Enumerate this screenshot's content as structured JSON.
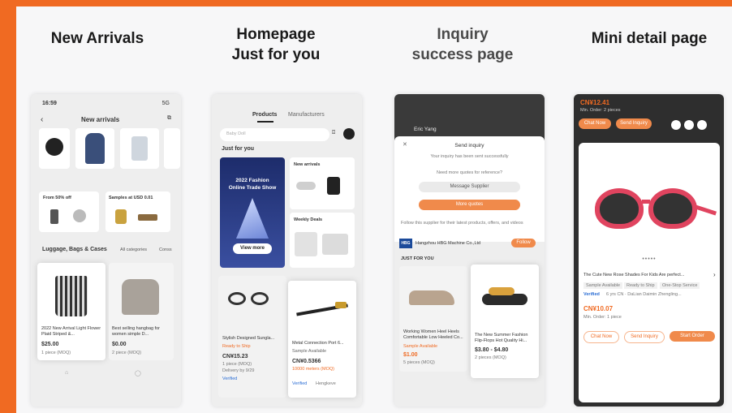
{
  "columns": [
    {
      "title": "New Arrivals"
    },
    {
      "title_line1": "Homepage",
      "title_line2": "Just for you"
    },
    {
      "title_line1": "Inquiry",
      "title_line2": "success page"
    },
    {
      "title": "Mini detail page"
    }
  ],
  "phone1": {
    "time": "16:59",
    "signal": "5G",
    "header": "New arrivals",
    "promo_left": "From 50% off",
    "promo_right": "Samples at USD 0.01",
    "category_tabs": [
      "Luggage, Bags & Cases",
      "All categories",
      "Conss"
    ],
    "product1": {
      "title": "2022 New Arrival Light Flower Plaid Striped &...",
      "price": "$25.00",
      "moq": "1 piece (MOQ)"
    },
    "product2": {
      "title": "Best selling hangbag for women simple D...",
      "price": "$0.00",
      "moq": "2 piece (MOQ)"
    }
  },
  "phone2": {
    "tabs": [
      "Products",
      "Manufacturers"
    ],
    "search_placeholder": "Baby Doll",
    "section": "Just for you",
    "banner": {
      "title": "2022 Fashion Online Trade Show",
      "cta": "View more"
    },
    "new_arrivals": "New arrivals",
    "weekly_deals": "Weekly Deals",
    "product1": {
      "title": "Stylish Designed Sungla...",
      "tag": "Ready to Ship",
      "price": "CN¥15.23",
      "moq": "1 piece (MOQ)",
      "delivery": "Delivery by 9/29",
      "verified": "Verified"
    },
    "product2": {
      "title": "Metal Connection Port 6...",
      "tag": "Sample Available",
      "price": "CN¥0.5366",
      "moq": "10000 meters (MOQ)",
      "verified": "Verified",
      "supplier": "Hengkeve"
    }
  },
  "phone3": {
    "chat_name": "Eric Yang",
    "sheet_title": "Send inquiry",
    "sent_msg": "Your inquiry has been sent successfully",
    "followup": "Need more quotes for reference?",
    "btn_message": "Message Supplier",
    "btn_quotes": "More quotes",
    "follow_text": "Follow this supplier for their latest products, offers, and videos",
    "supplier_badge": "HBG",
    "supplier": "Hangzhou HBG Machine Co.,Ltd",
    "follow_btn": "Follow",
    "section": "JUST FOR YOU",
    "product1": {
      "title": "Working Women Heel Heels Comfortable Low Heeled Co...",
      "tag": "Sample Available",
      "price": "$1.00",
      "moq": "5 pieces (MOQ)"
    },
    "product2": {
      "title": "The New Summer Fashion Flip-Flops Hot Quality Hi...",
      "price": "$3.80 - $4.80",
      "moq": "2 pieces (MOQ)"
    }
  },
  "phone4": {
    "price_top": "CN¥12.41",
    "moq_top": "Min. Order: 2 pieces",
    "btn_chat": "Chat Now",
    "btn_inquiry": "Send Inquiry",
    "title": "The Cute New Rose Shades For Kids Are perfect...",
    "chips": [
      "Sample Available",
      "Ready to Ship",
      "One-Stop Service"
    ],
    "verified": "Verified",
    "supplier": "6 yrs CN · DaLian Daimin Zhengling...",
    "price": "CN¥10.07",
    "moq": "Min. Order: 1 piece",
    "btn_chat_bottom": "Chat Now",
    "btn_inquiry_bottom": "Send Inquiry",
    "btn_order": "Start Order",
    "dots": "•••••"
  },
  "colors": {
    "accent": "#f06a22",
    "frame": "#f06a22",
    "canvas": "#f7f7f8"
  }
}
